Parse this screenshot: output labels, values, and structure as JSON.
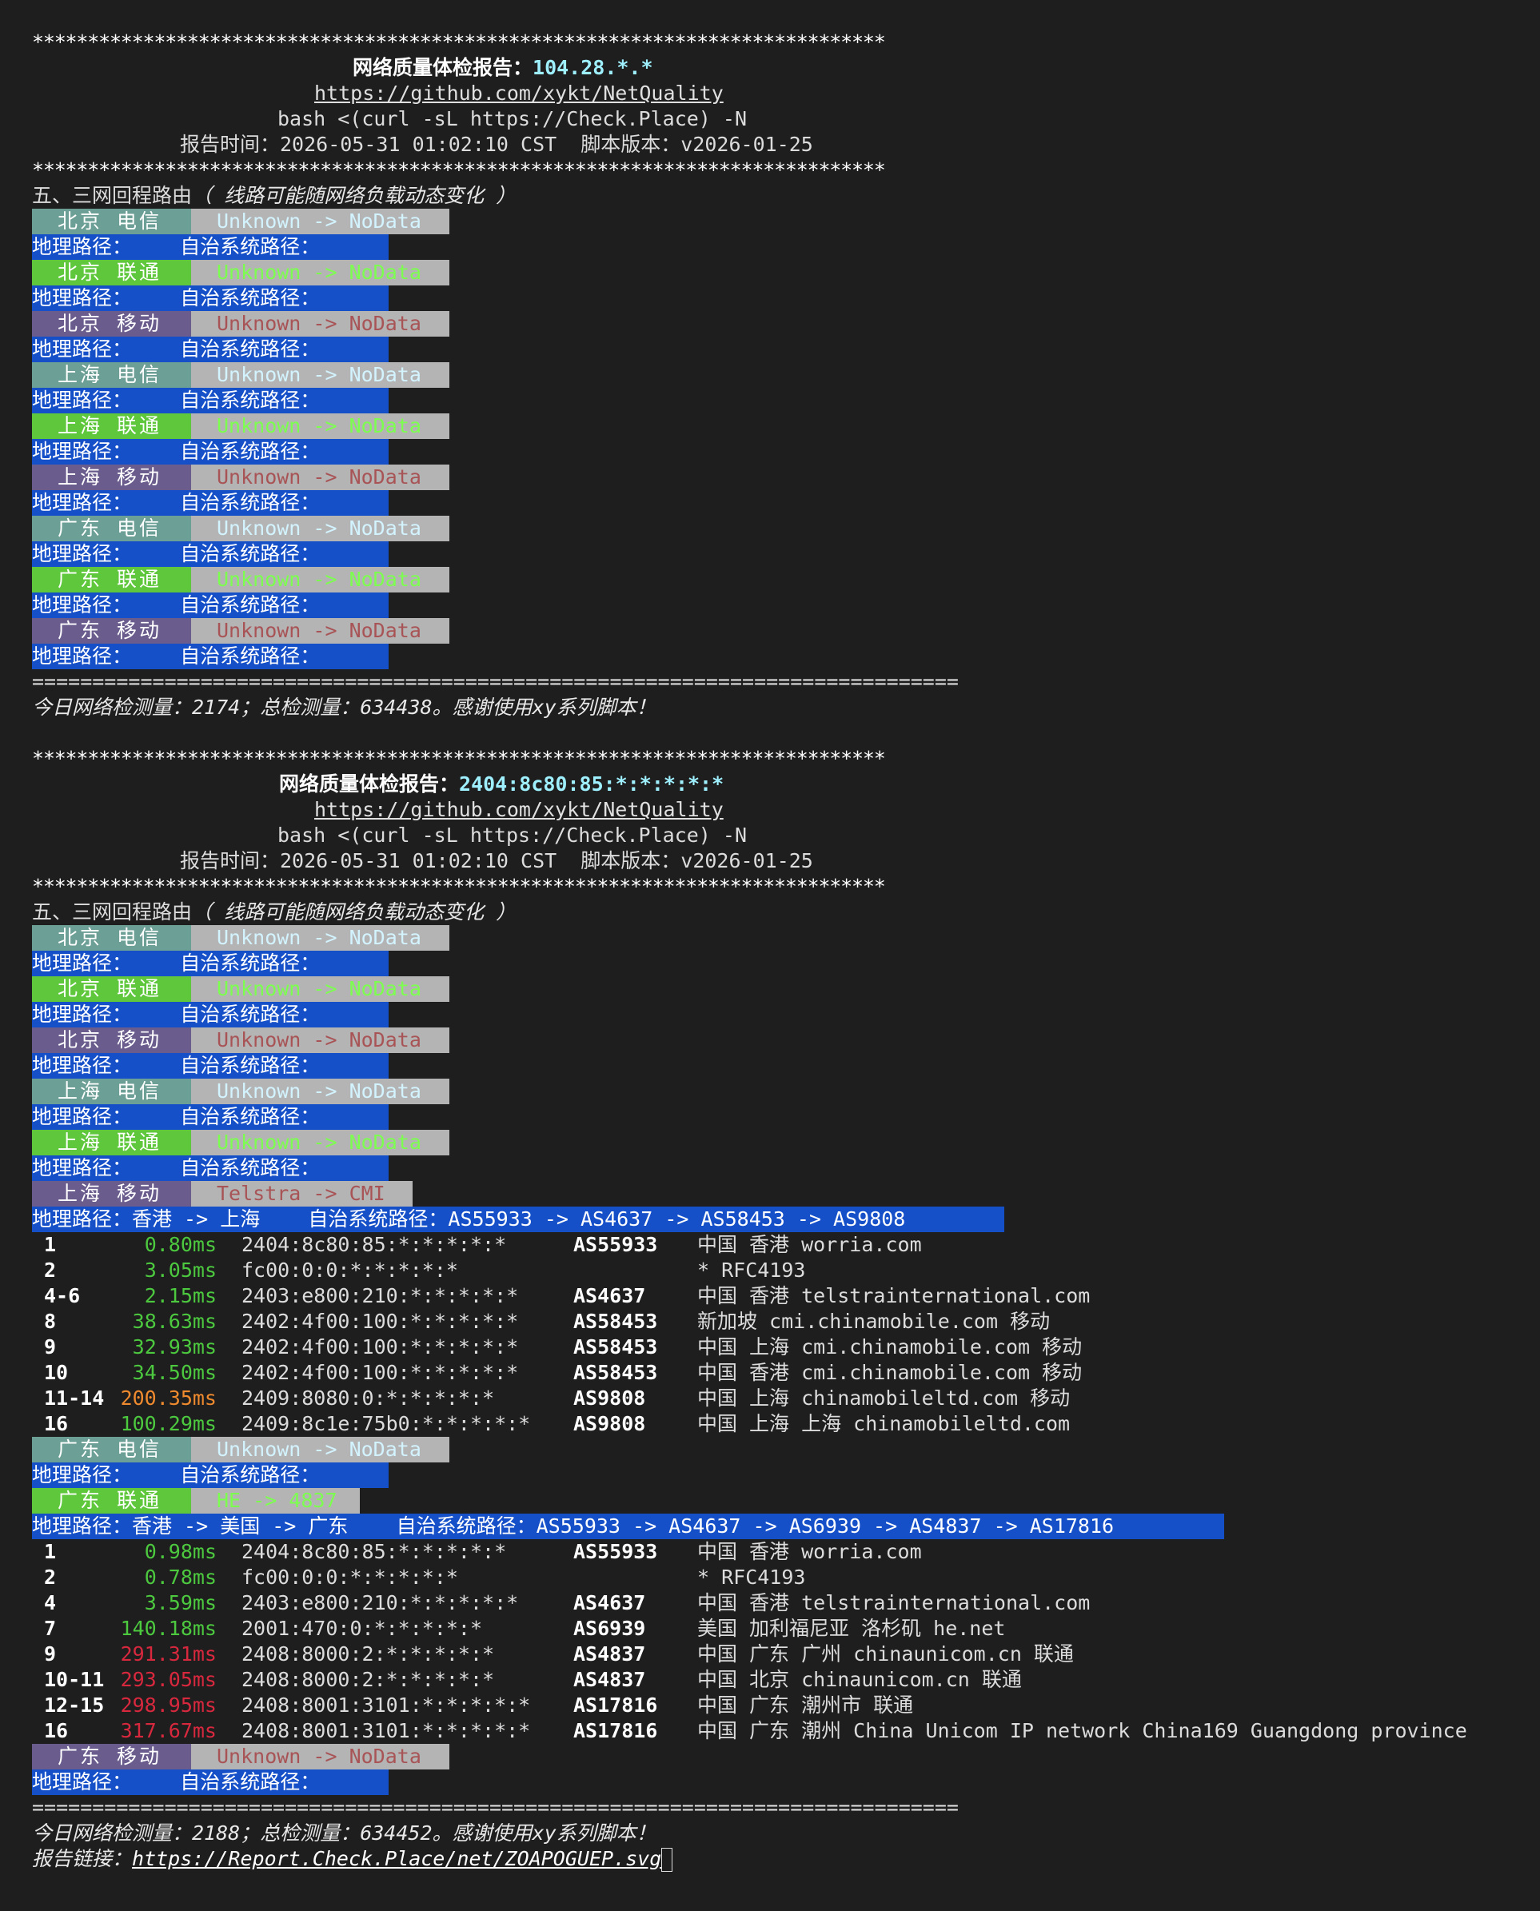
{
  "stars": "*****************************************************************************",
  "equals": "=============================================================================",
  "reports": [
    {
      "title_label": "网络质量体检报告：",
      "ip": "104.28.*.*",
      "github": "https://github.com/xykt/NetQuality",
      "command": "bash <(curl -sL https://Check.Place) -N",
      "time_line": "报告时间：2026-05-31 01:02:10 CST  脚本版本：v2026-01-25",
      "section": "五、三网回程路由",
      "section_note": "（ 线路可能随网络负载动态变化 ）",
      "footer": "今日网络检测量：2174；总检测量：634438。感谢使用xy系列脚本！"
    },
    {
      "title_label": "网络质量体检报告：",
      "ip": "2404:8c80:85:*:*:*:*:*",
      "github": "https://github.com/xykt/NetQuality",
      "command": "bash <(curl -sL https://Check.Place) -N",
      "time_line": "报告时间：2026-05-31 01:02:10 CST  脚本版本：v2026-01-25",
      "section": "五、三网回程路由",
      "section_note": "（ 线路可能随网络负载动态变化 ）",
      "footer": "今日网络检测量：2188；总检测量：634452。感谢使用xy系列脚本！",
      "report_link_label": "报告链接：",
      "report_link": "https://Report.Check.Place/net/ZOAPOGUEP.svg"
    }
  ],
  "carriers": [
    {
      "name": "北京 电信",
      "type": "ct"
    },
    {
      "name": "北京 联通",
      "type": "cu"
    },
    {
      "name": "北京 移动",
      "type": "cm"
    },
    {
      "name": "上海 电信",
      "type": "ct"
    },
    {
      "name": "上海 联通",
      "type": "cu"
    },
    {
      "name": "上海 移动",
      "type": "cm"
    },
    {
      "name": "广东 电信",
      "type": "ct"
    },
    {
      "name": "广东 联通",
      "type": "cu"
    },
    {
      "name": "广东 移动",
      "type": "cm"
    }
  ],
  "status_unknown": "Unknown -> NoData",
  "geo_empty": "地理路径：    自治系统路径：",
  "route_sh_cm": {
    "status": "Telstra -> CMI",
    "geo_line": "地理路径：香港 -> 上海    自治系统路径：AS55933 -> AS4637 -> AS58453 -> AS9808",
    "hops": [
      {
        "n": "1",
        "ms": "0.80ms",
        "lvl": "g",
        "ip": "2404:8c80:85:*:*:*:*:*",
        "as": "AS55933",
        "info": "中国 香港 worria.com"
      },
      {
        "n": "2",
        "ms": "3.05ms",
        "lvl": "g",
        "ip": "fc00:0:0:*:*:*:*:*",
        "as": "",
        "info": "* RFC4193"
      },
      {
        "n": "4-6",
        "ms": "2.15ms",
        "lvl": "g",
        "ip": "2403:e800:210:*:*:*:*:*",
        "as": "AS4637",
        "info": "中国 香港 telstrainternational.com"
      },
      {
        "n": "8",
        "ms": "38.63ms",
        "lvl": "g",
        "ip": "2402:4f00:100:*:*:*:*:*",
        "as": "AS58453",
        "info": "新加坡 cmi.chinamobile.com 移动"
      },
      {
        "n": "9",
        "ms": "32.93ms",
        "lvl": "g",
        "ip": "2402:4f00:100:*:*:*:*:*",
        "as": "AS58453",
        "info": "中国 上海 cmi.chinamobile.com 移动"
      },
      {
        "n": "10",
        "ms": "34.50ms",
        "lvl": "g",
        "ip": "2402:4f00:100:*:*:*:*:*",
        "as": "AS58453",
        "info": "中国 香港 cmi.chinamobile.com 移动"
      },
      {
        "n": "11-14",
        "ms": "200.35ms",
        "lvl": "o",
        "ip": "2409:8080:0:*:*:*:*:*",
        "as": "AS9808",
        "info": "中国 上海 chinamobileltd.com 移动"
      },
      {
        "n": "16",
        "ms": "100.29ms",
        "lvl": "g",
        "ip": "2409:8c1e:75b0:*:*:*:*:*",
        "as": "AS9808",
        "info": "中国 上海 上海 chinamobileltd.com"
      }
    ]
  },
  "route_gd_cu": {
    "status": "HE -> 4837",
    "geo_line": "地理路径：香港 -> 美国 -> 广东    自治系统路径：AS55933 -> AS4637 -> AS6939 -> AS4837 -> AS17816",
    "hops": [
      {
        "n": "1",
        "ms": "0.98ms",
        "lvl": "g",
        "ip": "2404:8c80:85:*:*:*:*:*",
        "as": "AS55933",
        "info": "中国 香港 worria.com"
      },
      {
        "n": "2",
        "ms": "0.78ms",
        "lvl": "g",
        "ip": "fc00:0:0:*:*:*:*:*",
        "as": "",
        "info": "* RFC4193"
      },
      {
        "n": "4",
        "ms": "3.59ms",
        "lvl": "g",
        "ip": "2403:e800:210:*:*:*:*:*",
        "as": "AS4637",
        "info": "中国 香港 telstrainternational.com"
      },
      {
        "n": "7",
        "ms": "140.18ms",
        "lvl": "g",
        "ip": "2001:470:0:*:*:*:*:*",
        "as": "AS6939",
        "info": "美国 加利福尼亚 洛杉矶 he.net"
      },
      {
        "n": "9",
        "ms": "291.31ms",
        "lvl": "r",
        "ip": "2408:8000:2:*:*:*:*:*",
        "as": "AS4837",
        "info": "中国 广东 广州 chinaunicom.cn 联通"
      },
      {
        "n": "10-11",
        "ms": "293.05ms",
        "lvl": "r",
        "ip": "2408:8000:2:*:*:*:*:*",
        "as": "AS4837",
        "info": "中国 北京 chinaunicom.cn 联通"
      },
      {
        "n": "12-15",
        "ms": "298.95ms",
        "lvl": "r",
        "ip": "2408:8001:3101:*:*:*:*:*",
        "as": "AS17816",
        "info": "中国 广东 潮州市 联通"
      },
      {
        "n": "16",
        "ms": "317.67ms",
        "lvl": "r",
        "ip": "2408:8001:3101:*:*:*:*:*",
        "as": "AS17816",
        "info": "中国 广东 潮州 China Unicom IP network China169 Guangdong province"
      }
    ]
  }
}
